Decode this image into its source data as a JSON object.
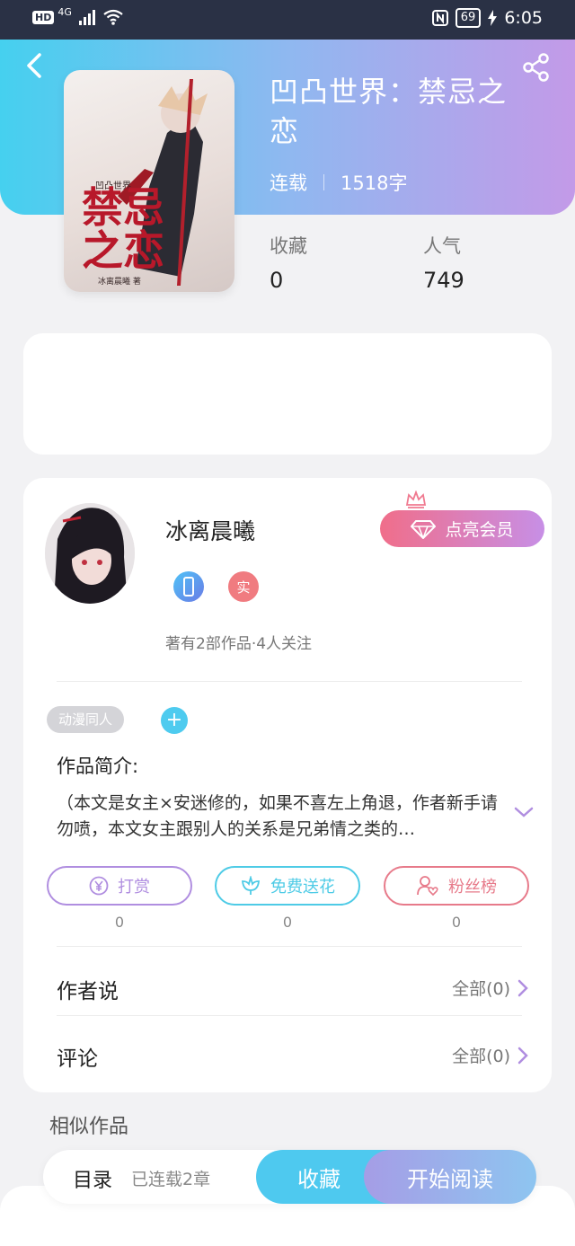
{
  "status_bar": {
    "hd": "HD",
    "network": "4G",
    "battery": "69",
    "time": "6:05"
  },
  "book": {
    "title": "凹凸世界：禁忌之恋",
    "status": "连载",
    "word_count": "1518字",
    "collect_label": "收藏",
    "collect_value": "0",
    "popularity_label": "人气",
    "popularity_value": "749",
    "cover": {
      "series": "凹凸世界",
      "title_line1": "禁忌",
      "title_line2": "之恋",
      "author": "冰离晨曦 著"
    }
  },
  "author": {
    "name": "冰离晨曦",
    "vip_label": "点亮会员",
    "badge_real": "实",
    "stats": "著有2部作品·4人关注"
  },
  "work": {
    "tag": "动漫同人",
    "intro_title": "作品简介:",
    "intro_text": "（本文是女主×安迷修的，如果不喜左上角退，作者新手请勿喷，本文女主跟别人的关系是兄弟情之类的…"
  },
  "actions": [
    {
      "label": "打赏",
      "count": "0",
      "color": "#b08ee0"
    },
    {
      "label": "免费送花",
      "count": "0",
      "color": "#4ecbe6"
    },
    {
      "label": "粉丝榜",
      "count": "0",
      "color": "#e77a8a"
    }
  ],
  "rows": {
    "author_say": "作者说",
    "author_say_all": "全部(0)",
    "comments": "评论",
    "comments_all": "全部(0)"
  },
  "similar_title": "相似作品",
  "bottom": {
    "catalog": "目录",
    "chapters": "已连载2章",
    "collect": "收藏",
    "read": "开始阅读"
  },
  "colors": {
    "accent_cyan": "#45d0ef",
    "accent_purple": "#c39ae8"
  }
}
